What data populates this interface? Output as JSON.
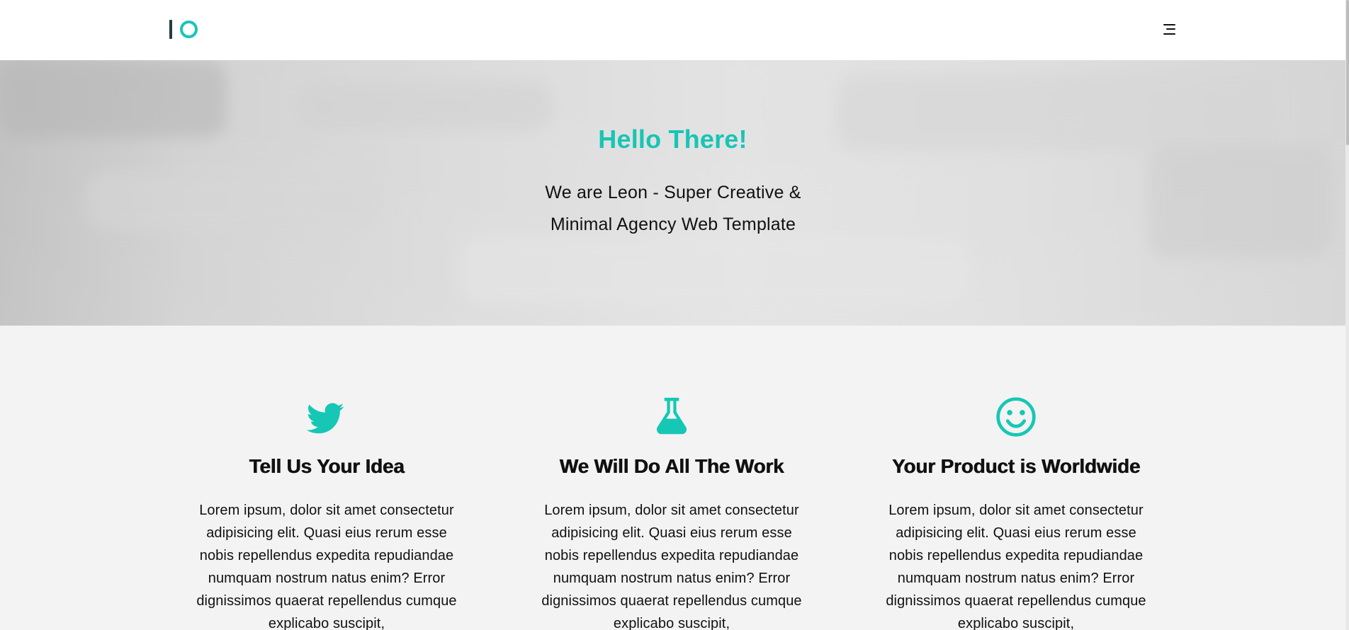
{
  "header": {
    "logo_name": "logo",
    "menu_icon": "hamburger-menu-icon"
  },
  "hero": {
    "title": "Hello There!",
    "subtitle": "We are Leon - Super Creative & Minimal Agency Web Template"
  },
  "features": [
    {
      "icon": "twitter-bird-icon",
      "title": "Tell Us Your Idea",
      "text": "Lorem ipsum, dolor sit amet consectetur adipisicing elit. Quasi eius rerum esse nobis repellendus expedita repudiandae numquam nostrum natus enim? Error dignissimos quaerat repellendus cumque explicabo suscipit,"
    },
    {
      "icon": "flask-icon",
      "title": "We Will Do All The Work",
      "text": "Lorem ipsum, dolor sit amet consectetur adipisicing elit. Quasi eius rerum esse nobis repellendus expedita repudiandae numquam nostrum natus enim? Error dignissimos quaerat repellendus cumque explicabo suscipit,"
    },
    {
      "icon": "smile-icon",
      "title": "Your Product is Worldwide",
      "text": "Lorem ipsum, dolor sit amet consectetur adipisicing elit. Quasi eius rerum esse nobis repellendus expedita repudiandae numquam nostrum natus enim? Error dignissimos quaerat repellendus cumque explicabo suscipit,"
    }
  ],
  "colors": {
    "accent": "#16c7b5",
    "text": "#111111",
    "header_background": "#ffffff",
    "features_background": "#f3f3f3",
    "logo_dark": "#243b44"
  }
}
